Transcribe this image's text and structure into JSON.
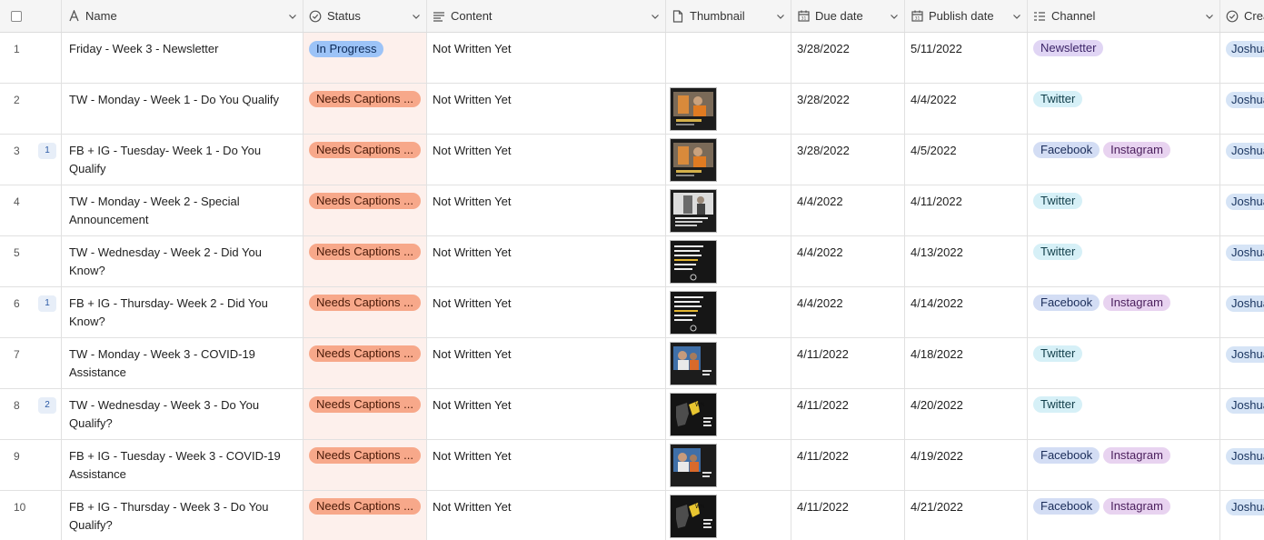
{
  "columns": {
    "name": "Name",
    "status": "Status",
    "content": "Content",
    "thumbnail": "Thumbnail",
    "due_date": "Due date",
    "publish_date": "Publish date",
    "channel": "Channel",
    "creator": "Crea"
  },
  "rows": [
    {
      "num": "1",
      "comments": "",
      "name": "Friday - Week 3 - Newsletter",
      "status": "In Progress",
      "content": "Not Written Yet",
      "thumbnail": "",
      "due": "3/28/2022",
      "publish": "5/11/2022",
      "channels": [
        "Newsletter"
      ],
      "creator": "Joshua"
    },
    {
      "num": "2",
      "comments": "",
      "name": "TW - Monday - Week 1 - Do You Qualify",
      "status": "Needs Captions ...",
      "content": "Not Written Yet",
      "thumbnail": "photo-orange",
      "due": "3/28/2022",
      "publish": "4/4/2022",
      "channels": [
        "Twitter"
      ],
      "creator": "Joshua"
    },
    {
      "num": "3",
      "comments": "1",
      "name": "FB + IG - Tuesday- Week 1 - Do You Qualify",
      "status": "Needs Captions ...",
      "content": "Not Written Yet",
      "thumbnail": "photo-orange",
      "due": "3/28/2022",
      "publish": "4/5/2022",
      "channels": [
        "Facebook",
        "Instagram"
      ],
      "creator": "Joshua"
    },
    {
      "num": "4",
      "comments": "",
      "name": "TW - Monday - Week 2 - Special Announcement",
      "status": "Needs Captions ...",
      "content": "Not Written Yet",
      "thumbnail": "photo-gray",
      "due": "4/4/2022",
      "publish": "4/11/2022",
      "channels": [
        "Twitter"
      ],
      "creator": "Joshua"
    },
    {
      "num": "5",
      "comments": "",
      "name": "TW - Wednesday - Week 2 - Did You Know?",
      "status": "Needs Captions ...",
      "content": "Not Written Yet",
      "thumbnail": "text-dark",
      "due": "4/4/2022",
      "publish": "4/13/2022",
      "channels": [
        "Twitter"
      ],
      "creator": "Joshua"
    },
    {
      "num": "6",
      "comments": "1",
      "name": "FB + IG - Thursday- Week 2 - Did You Know?",
      "status": "Needs Captions ...",
      "content": "Not Written Yet",
      "thumbnail": "text-dark",
      "due": "4/4/2022",
      "publish": "4/14/2022",
      "channels": [
        "Facebook",
        "Instagram"
      ],
      "creator": "Joshua"
    },
    {
      "num": "7",
      "comments": "",
      "name": "TW - Monday - Week 3 - COVID-19 Assistance",
      "status": "Needs Captions ...",
      "content": "Not Written Yet",
      "thumbnail": "photo-blue",
      "due": "4/11/2022",
      "publish": "4/18/2022",
      "channels": [
        "Twitter"
      ],
      "creator": "Joshua"
    },
    {
      "num": "8",
      "comments": "2",
      "name": "TW - Wednesday - Week 3 - Do You Qualify?",
      "status": "Needs Captions ...",
      "content": "Not Written Yet",
      "thumbnail": "map-dark",
      "due": "4/11/2022",
      "publish": "4/20/2022",
      "channels": [
        "Twitter"
      ],
      "creator": "Joshua"
    },
    {
      "num": "9",
      "comments": "",
      "name": "FB + IG - Tuesday - Week 3 - COVID-19 Assistance",
      "status": "Needs Captions ...",
      "content": "Not Written Yet",
      "thumbnail": "photo-blue",
      "due": "4/11/2022",
      "publish": "4/19/2022",
      "channels": [
        "Facebook",
        "Instagram"
      ],
      "creator": "Joshua"
    },
    {
      "num": "10",
      "comments": "",
      "name": "FB + IG - Thursday - Week 3 - Do You Qualify?",
      "status": "Needs Captions ...",
      "content": "Not Written Yet",
      "thumbnail": "map-dark",
      "due": "4/11/2022",
      "publish": "4/21/2022",
      "channels": [
        "Facebook",
        "Instagram"
      ],
      "creator": "Joshua"
    }
  ],
  "colors": {
    "status_in_progress": "#9cc3f7",
    "status_needs_captions": "#f7a88a",
    "status_column_bg": "#fdf0ec"
  },
  "icons": {
    "name": "text-a-icon",
    "status": "circle-check-icon",
    "content": "long-text-icon",
    "thumbnail": "attachment-file-icon",
    "due_date": "calendar-icon",
    "publish_date": "calendar-icon",
    "channel": "multi-select-icon",
    "creator": "circle-check-icon"
  }
}
